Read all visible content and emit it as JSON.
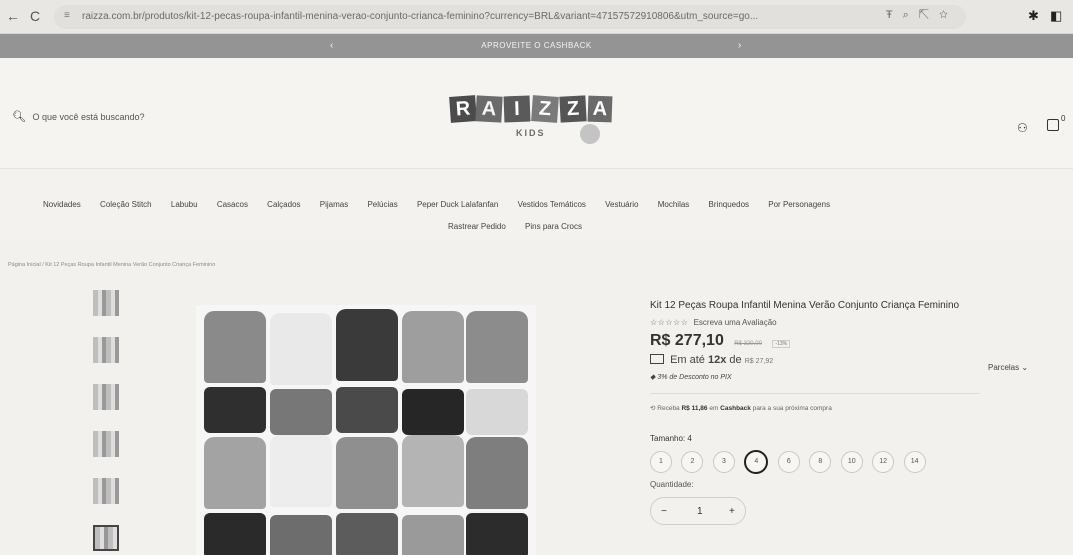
{
  "browser": {
    "url": "raizza.com.br/produtos/kit-12-pecas-roupa-infantil-menina-verao-conjunto-crianca-feminino?currency=BRL&variant=47157572910806&utm_source=go...",
    "back_icon": "arrow-left-icon",
    "reload_label": "C"
  },
  "promo": {
    "text": "APROVEITE O CASHBACK",
    "prev": "‹",
    "next": "›"
  },
  "header": {
    "search_placeholder": "O que você está buscando?",
    "logo_letters": [
      "R",
      "A",
      "I",
      "Z",
      "Z",
      "A"
    ],
    "logo_sub": "KIDS",
    "cart_count": "0"
  },
  "menu": {
    "row1": [
      "Novidades",
      "Coleção Stitch",
      "Labubu",
      "Casacos",
      "Calçados",
      "Pijamas",
      "Pelúcias",
      "Peper Duck Lalafanfan",
      "Vestidos Temáticos",
      "Vestuário",
      "Mochilas",
      "Brinquedos",
      "Por Personagens"
    ],
    "row2": [
      "Rastrear Pedido",
      "Pins para Crocs"
    ]
  },
  "breadcrumb": "Página Inicial / Kit 12 Peças Roupa Infantil Menina Verão Conjunto Criança Feminino",
  "product": {
    "title": "Kit 12 Peças Roupa Infantil Menina Verão Conjunto Criança Feminino",
    "stars": "☆☆☆☆☆",
    "review_link": "Escreva uma Avaliação",
    "price": "R$ 277,10",
    "old_price": "R$ 320,00",
    "discount_badge": "-13%",
    "installment_prefix": "Em até",
    "installment_count": "12x",
    "installment_suffix": "de",
    "installment_value": "R$ 27,92",
    "parcelas": "Parcelas",
    "pix": "3% de Desconto no PIX",
    "cashback_prefix": "Receba",
    "cashback_value": "R$ 11,86",
    "cashback_mid": "em",
    "cashback_word": "Cashback",
    "cashback_suffix": "para a sua próxima compra",
    "size_label": "Tamanho:",
    "selected_size": "4",
    "sizes": [
      "1",
      "2",
      "3",
      "4",
      "6",
      "8",
      "10",
      "12",
      "14"
    ],
    "quantity_label": "Quantidade:",
    "quantity": "1"
  },
  "colors": {
    "promo_bg": "#949494",
    "text": "#333333",
    "background": "#f5f4f1"
  }
}
